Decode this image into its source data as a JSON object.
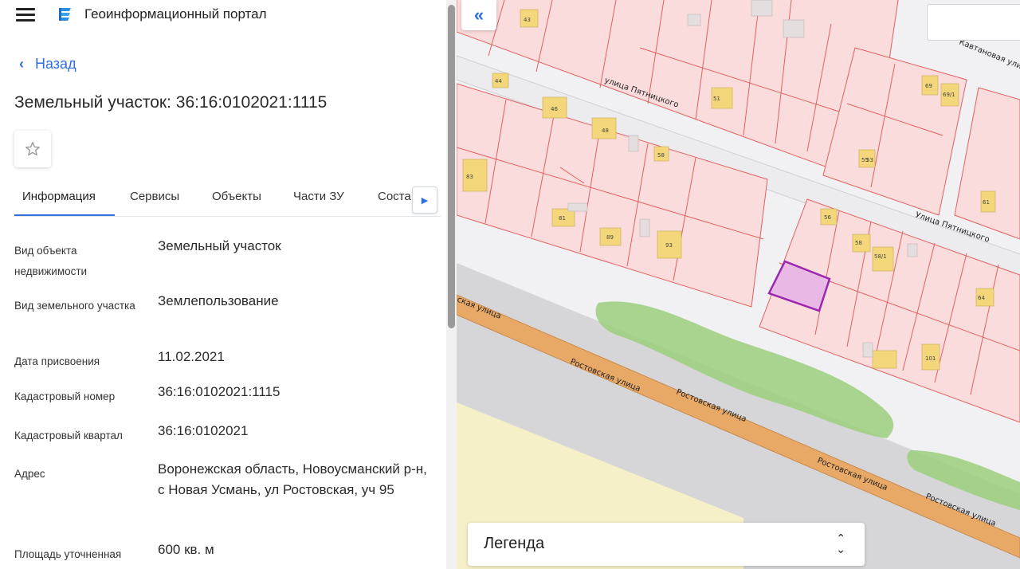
{
  "app": {
    "title": "Геоинформационный портал",
    "menu_icon": "hamburger-menu-icon",
    "logo_icon": "portal-logo-icon"
  },
  "nav": {
    "back_label": "Назад"
  },
  "page": {
    "title": "Земельный участок: 36:16:0102021:1115",
    "favorite_icon": "star-icon"
  },
  "tabs": [
    {
      "label": "Информация",
      "active": true
    },
    {
      "label": "Сервисы",
      "active": false
    },
    {
      "label": "Объекты",
      "active": false
    },
    {
      "label": "Части ЗУ",
      "active": false
    },
    {
      "label": "Соста",
      "active": false
    }
  ],
  "details": [
    {
      "label": "Вид объекта недвижимости",
      "value": "Земельный участок"
    },
    {
      "label": "Вид земельного участка",
      "value": "Землепользование"
    },
    {
      "label": "Дата присвоения",
      "value": "11.02.2021"
    },
    {
      "label": "Кадастровый номер",
      "value": "36:16:0102021:1115"
    },
    {
      "label": "Кадастровый квартал",
      "value": "36:16:0102021"
    },
    {
      "label": "Адрес",
      "value": "Воронежская область, Новоусманский р-н, с Новая Усмань, ул Ростовская, уч 95"
    },
    {
      "label": "Площадь уточненная",
      "value": "600 кв. м"
    }
  ],
  "map": {
    "collapse_icon": "double-chevron-left-icon",
    "legend_label": "Легенда",
    "legend_toggle_icon": "chevron-up-down-icon",
    "streets": {
      "pyatnitskogo": "улица Пятницкого",
      "pyatnitskogo_2": "Улица Пятницкого",
      "kavtanovaya": "Кавтановая улица",
      "rostovskaya_1": "Ростовская улица",
      "rostovskaya_2": "Ростовская улица",
      "rostovskaya_3": "Ростовская улица",
      "rostovskaya_4": "Ростовская улица",
      "rostovskaya_5": "Ростовская улица",
      "rostovskaya_cut": "ская улица"
    },
    "plot_numbers": [
      "43",
      "44",
      "46",
      "48",
      "58",
      "51",
      "53",
      "83",
      "81",
      "89",
      "93",
      "56",
      "58",
      "58/1",
      "69",
      "69/1",
      "55",
      "61",
      "64",
      "101"
    ],
    "colors": {
      "plot_fill": "#fbdcdc",
      "plot_border": "#e06060",
      "selected_plot": "#e9b8e4",
      "selected_border": "#9b27b0",
      "road": "#e8a866",
      "green": "#9bcf7c",
      "building": "#f3d77a"
    }
  }
}
